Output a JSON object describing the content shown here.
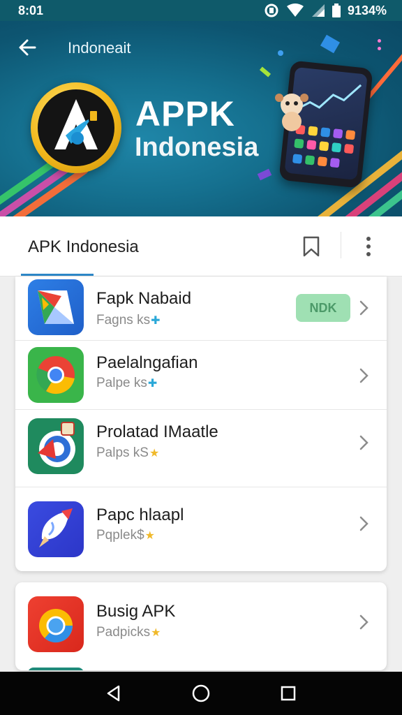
{
  "status_bar": {
    "time": "8:01",
    "battery": "9134%"
  },
  "hero": {
    "title": "Indoneait",
    "brand_line1": "APPK",
    "brand_line2": "Indonesia"
  },
  "title_bar": {
    "title": "APK Indonesia"
  },
  "apps": [
    {
      "name": "Fapk Nabaid",
      "sub": "Fagns ks",
      "star": "✚",
      "badge": "NDK"
    },
    {
      "name": "Paelalngafian",
      "sub": "Palpe ks",
      "star": "✚"
    },
    {
      "name": "Prolatad IMaatle",
      "sub": "Palps kS",
      "star": "★"
    },
    {
      "name": "Papc hlaapl",
      "sub": "Pqplek$",
      "star": "★"
    },
    {
      "name": "Busig APK",
      "sub": "Padpicks",
      "star": "★"
    }
  ],
  "colors": {
    "accent": "#2e88c8",
    "badge_bg": "#9fe0b3",
    "hero_bg": "#15708f",
    "star_blue": "#2aa8d8",
    "star_gold": "#f0b92a"
  },
  "icons": {
    "back": "arrow-left-icon",
    "bookmark": "bookmark-icon",
    "more": "more-vertical-icon",
    "chevron": "chevron-right-icon",
    "nav_back": "triangle-back-icon",
    "nav_home": "circle-home-icon",
    "nav_recents": "square-recents-icon"
  }
}
